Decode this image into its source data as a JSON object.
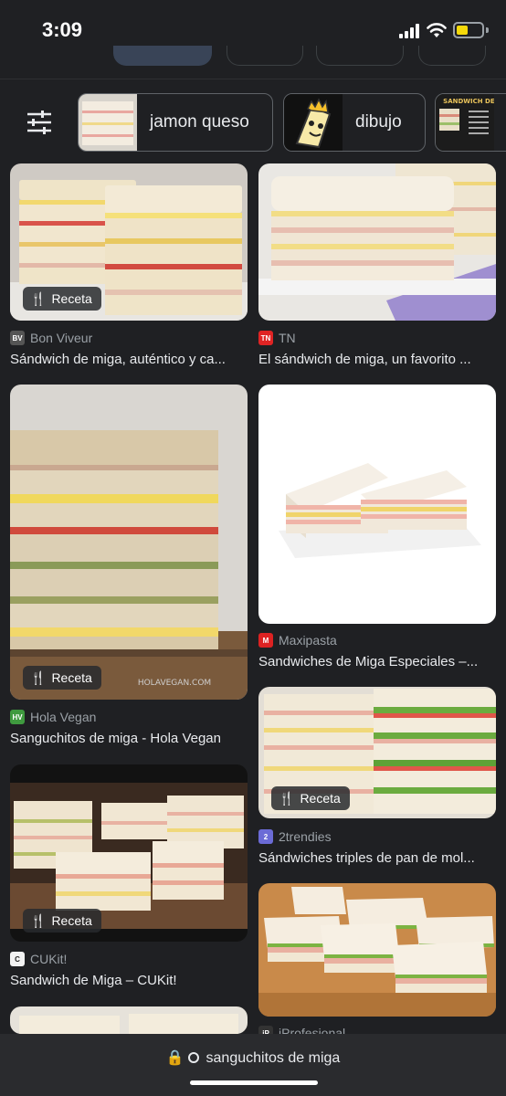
{
  "status": {
    "time": "3:09"
  },
  "filters": {
    "settings_icon": "tune-icon",
    "chips": [
      {
        "label": "jamon queso",
        "thumb": "sandwich-photo"
      },
      {
        "label": "dibujo",
        "thumb": "cartoon-sandwich"
      },
      {
        "label": "SANDWICH DE MIGA",
        "thumb": "sandwich-menu"
      }
    ]
  },
  "results": [
    {
      "source": "Bon Viveur",
      "favicon": "BV",
      "title": "Sándwich de miga, auténtico y ca...",
      "badge": "Receta"
    },
    {
      "source": "TN",
      "favicon": "TN",
      "title": "El sándwich de miga, un favorito ..."
    },
    {
      "source": "Hola Vegan",
      "favicon": "HV",
      "title": "Sanguchitos de miga - Hola Vegan",
      "badge": "Receta",
      "watermark": "HOLAVEGAN.COM"
    },
    {
      "source": "Maxipasta",
      "favicon": "M",
      "title": "Sandwiches de Miga Especiales –..."
    },
    {
      "source": "2trendies",
      "favicon": "2",
      "title": "Sándwiches triples de pan de mol...",
      "badge": "Receta"
    },
    {
      "source": "CUKit!",
      "favicon": "C",
      "title": "Sandwich de Miga – CUKit!",
      "badge": "Receta"
    },
    {
      "source": "iProfesional",
      "favicon": "iP",
      "title": ""
    }
  ],
  "address_bar": {
    "text": "sanguchitos de miga",
    "lock_icon": "lock-icon",
    "search_icon": "search-icon"
  },
  "colors": {
    "background": "#1f2023",
    "chip_border": "#5f6368",
    "battery": "#f5d90a"
  }
}
